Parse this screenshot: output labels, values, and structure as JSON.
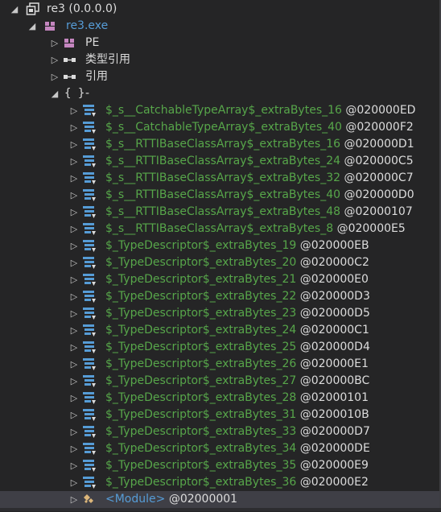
{
  "root": {
    "label": "re3 (0.0.0.0)"
  },
  "module": {
    "label": "re3.exe"
  },
  "pe": {
    "label": "PE"
  },
  "typeRefs": {
    "label": "类型引用"
  },
  "refs": {
    "label": "引用"
  },
  "namespace": {
    "label": "{ }",
    "name": "-"
  },
  "types": [
    {
      "name": "$_s__CatchableTypeArray$_extraBytes_16",
      "token": "@020000ED"
    },
    {
      "name": "$_s__CatchableTypeArray$_extraBytes_40",
      "token": "@020000F2"
    },
    {
      "name": "$_s__RTTIBaseClassArray$_extraBytes_16",
      "token": "@020000D1"
    },
    {
      "name": "$_s__RTTIBaseClassArray$_extraBytes_24",
      "token": "@020000C5"
    },
    {
      "name": "$_s__RTTIBaseClassArray$_extraBytes_32",
      "token": "@020000C7"
    },
    {
      "name": "$_s__RTTIBaseClassArray$_extraBytes_40",
      "token": "@020000D0"
    },
    {
      "name": "$_s__RTTIBaseClassArray$_extraBytes_48",
      "token": "@02000107"
    },
    {
      "name": "$_s__RTTIBaseClassArray$_extraBytes_8",
      "token": "@020000E5"
    },
    {
      "name": "$_TypeDescriptor$_extraBytes_19",
      "token": "@020000EB"
    },
    {
      "name": "$_TypeDescriptor$_extraBytes_20",
      "token": "@020000C2"
    },
    {
      "name": "$_TypeDescriptor$_extraBytes_21",
      "token": "@020000E0"
    },
    {
      "name": "$_TypeDescriptor$_extraBytes_22",
      "token": "@020000D3"
    },
    {
      "name": "$_TypeDescriptor$_extraBytes_23",
      "token": "@020000D5"
    },
    {
      "name": "$_TypeDescriptor$_extraBytes_24",
      "token": "@020000C1"
    },
    {
      "name": "$_TypeDescriptor$_extraBytes_25",
      "token": "@020000D4"
    },
    {
      "name": "$_TypeDescriptor$_extraBytes_26",
      "token": "@020000E1"
    },
    {
      "name": "$_TypeDescriptor$_extraBytes_27",
      "token": "@020000BC"
    },
    {
      "name": "$_TypeDescriptor$_extraBytes_28",
      "token": "@02000101"
    },
    {
      "name": "$_TypeDescriptor$_extraBytes_31",
      "token": "@0200010B"
    },
    {
      "name": "$_TypeDescriptor$_extraBytes_33",
      "token": "@020000D7"
    },
    {
      "name": "$_TypeDescriptor$_extraBytes_34",
      "token": "@020000DE"
    },
    {
      "name": "$_TypeDescriptor$_extraBytes_35",
      "token": "@020000E9"
    },
    {
      "name": "$_TypeDescriptor$_extraBytes_36",
      "token": "@020000E2"
    }
  ],
  "moduleType": {
    "name": "<Module>",
    "token": "@02000001"
  },
  "colors": {
    "background": "#252526",
    "typeName": "#57a64a",
    "moduleName": "#569cd6",
    "selection": "#3f3f46"
  },
  "icons": {
    "root": "assembly-icon",
    "module": "module-icon",
    "pe": "pe-icon",
    "typeRefs": "type-refs-icon",
    "refs": "refs-icon",
    "type": "struct-icon",
    "moduleType": "module-class-icon"
  }
}
